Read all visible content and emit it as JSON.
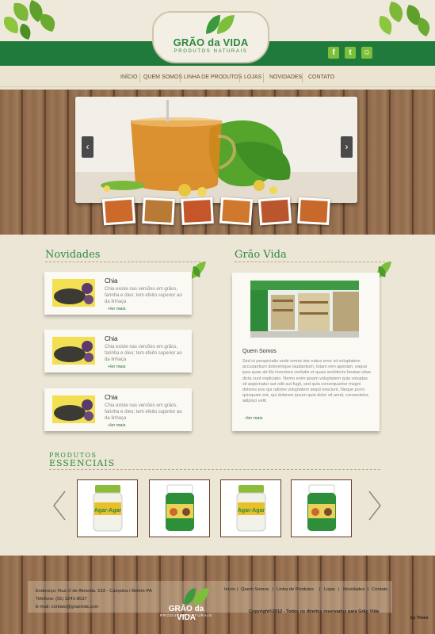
{
  "header": {
    "logo_word": "GRÃO da VIDA",
    "logo_sub": "PRODUTOS NATURAIS",
    "social": [
      {
        "icon": "facebook-icon",
        "glyph": "f"
      },
      {
        "icon": "twitter-icon",
        "glyph": "t"
      },
      {
        "icon": "chat-icon",
        "glyph": "☺"
      }
    ]
  },
  "nav": [
    "INÍCIO",
    "QUEM SOMOS",
    "LINHA DE PRODUTOS",
    "LOJAS",
    "NOVIDADES",
    "CONTATO"
  ],
  "slider": {
    "prev": "‹",
    "next": "›"
  },
  "novidades": {
    "title": "Novidades",
    "items": [
      {
        "title": "Chia",
        "text": "Chia existe nas versões em grãos, farinha e óleo; tem efeito superior ao da linhaça",
        "more": "+ler mais"
      },
      {
        "title": "Chia",
        "text": "Chia existe nas versões em grãos, farinha e óleo; tem efeito superior ao da linhaça",
        "more": "+ler mais"
      },
      {
        "title": "Chia",
        "text": "Chia existe nas versões em grãos, farinha e óleo; tem efeito superior ao da linhaça",
        "more": "+ler mais"
      }
    ]
  },
  "grao_vida": {
    "title": "Grão Vida",
    "heading": "Quem Somos",
    "text": "Sed ut perspiciatis unde omnis iste natus error sit voluptatem accusantium doloremque laudantium, totam rem aperiam, eaque ipsa quae ab illo inventore veritatis et quasi architecto beatae vitae dicta sunt explicabo. Nemo enim ipsam voluptatem quia voluptas sit aspernatur aut odit aut fugit, sed quia consequuntur magni dolores eos qui ratione voluptatem sequi nesciunt. Neque porro quisquam est, qui dolorem ipsum quia dolor sit amet, consectetur, adipisci velit.",
    "more": "+ler mais"
  },
  "produtos": {
    "title_top": "PRODUTOS",
    "title_bottom": "ESSENCIAIS",
    "items": [
      {
        "label": "Agar-Agar",
        "cap": "#8dbb3a"
      },
      {
        "label": "",
        "cap": "#ffffff"
      },
      {
        "label": "Agar-Agar",
        "cap": "#8dbb3a"
      },
      {
        "label": "",
        "cap": "#ffffff"
      }
    ]
  },
  "footer": {
    "address": "Endereço: Rua O de Almeida, 533 - Campina / Belém-PA",
    "phone": "Telefone: (91) 3241-8537",
    "email": "E-mail: contato@graovida.com",
    "logo_word": "GRÃO da VIDA",
    "logo_sub": "PRODUTOS NATURAIS",
    "links": [
      "Início",
      "Quem Somos",
      "Linha de Produtos",
      "Lojas",
      "Novidades",
      "Contato"
    ],
    "copyright": "Copyright©2012 - Todos os direitos reservados para Grão Vida",
    "credit": "by Tineo"
  },
  "colors": {
    "green": "#1f7a3c",
    "leaf": "#7cbf3b",
    "nav_text": "#6b4a2a",
    "wood": "#8a6346"
  }
}
